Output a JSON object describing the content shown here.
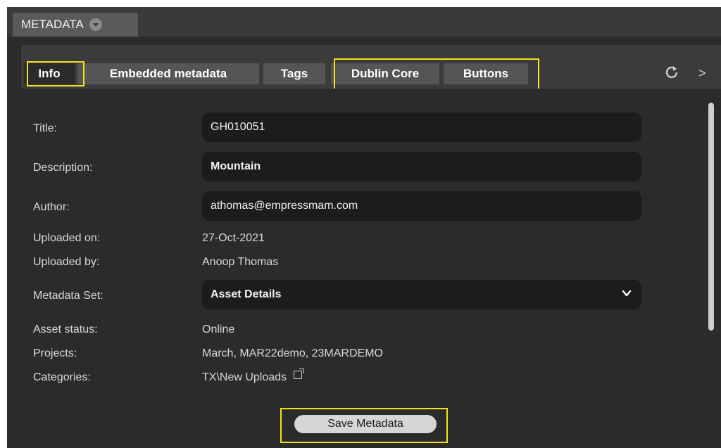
{
  "panel": {
    "title": "METADATA"
  },
  "tabs": [
    {
      "label": "Info",
      "active": true
    },
    {
      "label": "Embedded metadata",
      "active": false
    },
    {
      "label": "Tags",
      "active": false
    },
    {
      "label": "Dublin Core",
      "active": false
    },
    {
      "label": "Buttons",
      "active": false
    }
  ],
  "toolbar": {
    "refresh_icon": "refresh-icon",
    "more_icon": "chevron-right-icon",
    "more_glyph": ">"
  },
  "fields": {
    "title": {
      "label": "Title:",
      "value": "GH010051"
    },
    "description": {
      "label": "Description:",
      "value": "Mountain"
    },
    "author": {
      "label": "Author:",
      "value": "athomas@empressmam.com"
    },
    "uploaded_on": {
      "label": "Uploaded on:",
      "value": "27-Oct-2021"
    },
    "uploaded_by": {
      "label": "Uploaded by:",
      "value": "Anoop Thomas"
    },
    "metadata_set": {
      "label": "Metadata Set:",
      "value": "Asset Details"
    },
    "asset_status": {
      "label": "Asset status:",
      "value": "Online"
    },
    "projects": {
      "label": "Projects:",
      "value": "March, MAR22demo, 23MARDEMO"
    },
    "categories": {
      "label": "Categories:",
      "value": "TX\\New Uploads"
    }
  },
  "footer": {
    "save_label": "Save Metadata"
  },
  "colors": {
    "panel_bg": "#2b2b2b",
    "tab_bg": "#555555",
    "highlight": "#f0e318",
    "field_bg": "#1c1c1c"
  }
}
